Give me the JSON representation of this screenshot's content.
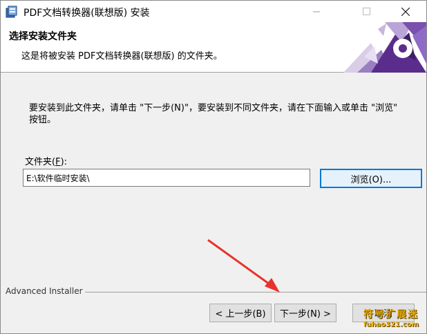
{
  "window": {
    "title": "PDF文档转换器(联想版) 安装"
  },
  "header": {
    "title": "选择安装文件夹",
    "subtitle": "这是将被安装 PDF文档转换器(联想版) 的文件夹。"
  },
  "body": {
    "instruction": "要安装到此文件夹，请单击 \"下一步(N)\"，要安装到不同文件夹，请在下面输入或单击 \"浏览\" 按钮。",
    "folder_label_prefix": "文件夹(",
    "folder_label_key": "F",
    "folder_label_suffix": "):",
    "folder_value": "E:\\软件临时安装\\",
    "browse_label": "浏览(O)..."
  },
  "footer": {
    "brand": "Advanced Installer",
    "back_label": "< 上一步(B)",
    "next_label": "下一步(N) >",
    "cancel_label": "取消"
  },
  "watermark": {
    "line1": "符号扩展迷",
    "line2": "fuhao321.com"
  },
  "colors": {
    "accent": "#0078d7",
    "arrow": "#e8322d",
    "banner_purple": "#5a2d8c"
  }
}
